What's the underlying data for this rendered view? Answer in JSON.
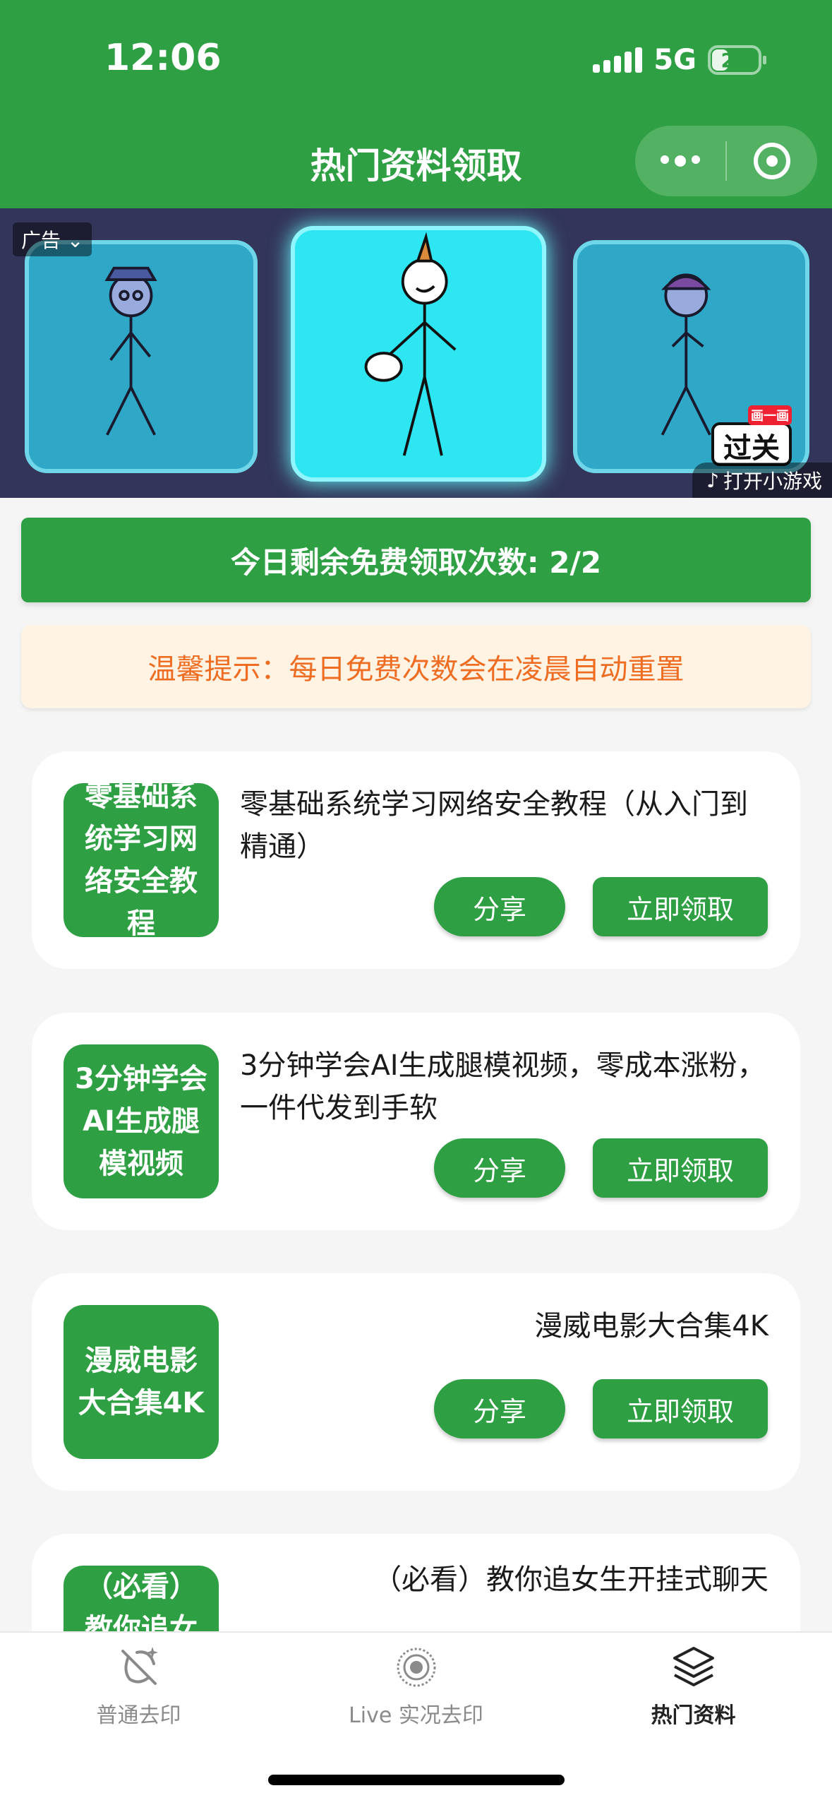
{
  "status_bar": {
    "time": "12:06",
    "network": "5G",
    "battery": "25"
  },
  "nav": {
    "title": "热门资料领取"
  },
  "ad": {
    "tag": "广告",
    "open_game": "打开小游戏",
    "logo_text": "过关",
    "logo_small": "画一画"
  },
  "remaining": {
    "text": "今日剩余免费领取次数: 2/2"
  },
  "tip": {
    "text": "温馨提示：每日免费次数会在凌晨自动重置"
  },
  "items": [
    {
      "thumb": "零基础系统学习网络安全教程",
      "title": "零基础系统学习网络安全教程（从入门到精通）",
      "share_label": "分享",
      "get_label": "立即领取"
    },
    {
      "thumb": "3分钟学会AI生成腿模视频",
      "title": "3分钟学会AI生成腿模视频，零成本涨粉，一件代发到手软",
      "share_label": "分享",
      "get_label": "立即领取"
    },
    {
      "thumb": "漫威电影大合集4K",
      "title": "漫威电影大合集4K",
      "share_label": "分享",
      "get_label": "立即领取"
    },
    {
      "thumb": "（必看）教你追女",
      "title": "（必看）教你追女生开挂式聊天"
    }
  ],
  "tabbar": {
    "tabs": [
      {
        "label": "普通去印",
        "icon": "no-watermark-icon"
      },
      {
        "label": "Live 实况去印",
        "icon": "live-photo-icon"
      },
      {
        "label": "热门资料",
        "icon": "layers-icon"
      }
    ]
  },
  "colors": {
    "primary": "#2ea043",
    "tip_bg": "#fff3e4",
    "tip_text": "#ee6d22"
  }
}
